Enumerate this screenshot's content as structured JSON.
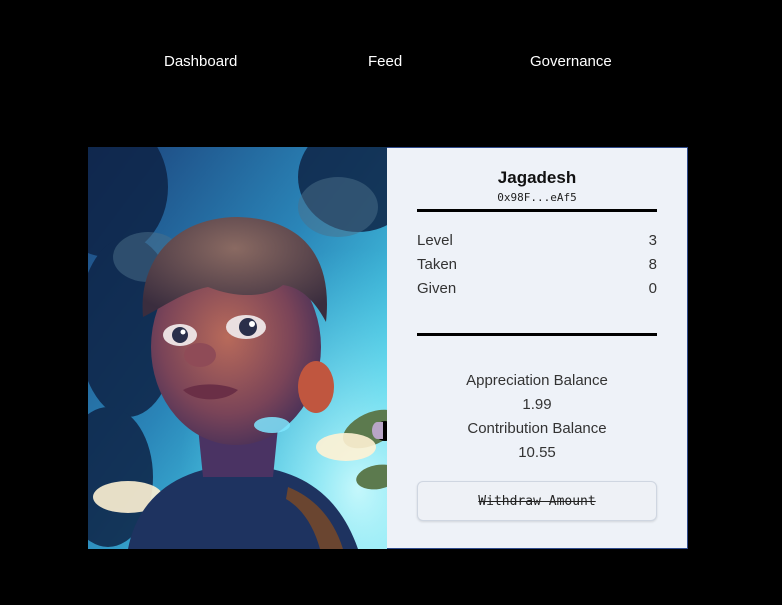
{
  "nav": {
    "items": [
      {
        "label": "Dashboard"
      },
      {
        "label": "Feed"
      },
      {
        "label": "Governance"
      }
    ]
  },
  "profile": {
    "name": "Jagadesh",
    "address": "0x98F...eAf5",
    "stats": [
      {
        "label": "Level",
        "value": "3"
      },
      {
        "label": "Taken",
        "value": "8"
      },
      {
        "label": "Given",
        "value": "0"
      }
    ],
    "appreciation_label": "Appreciation Balance",
    "appreciation_value": "1.99",
    "contribution_label": "Contribution Balance",
    "contribution_value": "10.55",
    "withdraw_label": "Withdraw Amount"
  },
  "colors": {
    "background": "#000000",
    "panel": "#eef2f8",
    "panel_border": "#2f4b8c"
  },
  "icons": {
    "slider_handle": "compare-handle-icon"
  }
}
